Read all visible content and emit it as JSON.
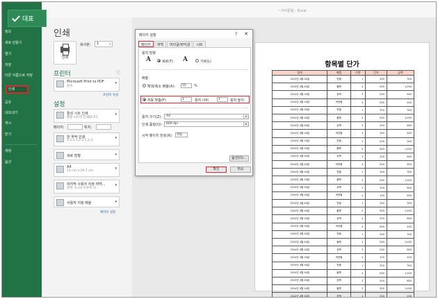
{
  "window": {
    "title": "~서식문용 - Excel"
  },
  "nav": {
    "back_label": "대표",
    "items": [
      "정보",
      "새로 만들기",
      "열기",
      "저장",
      "다른 이름으로 저장",
      "인쇄",
      "공유",
      "내보내기",
      "게시",
      "닫기",
      "계정",
      "옵션"
    ],
    "selected": "인쇄"
  },
  "print": {
    "heading": "인쇄",
    "button_label": "인쇄",
    "copies_label": "복사본:",
    "copies_value": "1",
    "printer_heading": "프린터",
    "printer_name": "Microsoft Print to PDF",
    "printer_status": "준비",
    "printer_props": "프린터 속성",
    "settings_heading": "설정",
    "setting1_title": "활성 시트 인쇄",
    "setting1_sub": "활성 시트만 인쇄합니다",
    "pages_label": "페이지:",
    "to_label": "위치:",
    "setting2_title": "한 부씩 인쇄",
    "setting2_sub": "1,2,3   1,2,3   1,2,3",
    "setting3_title": "세로 방향",
    "setting4_title": "A4",
    "setting4_sub": "21 cm x 29.7 cm",
    "setting5_title": "마지막 사용자 지정 여백...",
    "setting5_sub": "왼쪽: 0 cm   오른쪽: 0...",
    "setting6_title": "사용자 지정 배율",
    "page_setup_link": "페이지 설정"
  },
  "dialog": {
    "title": "페이지 설정",
    "help": "?",
    "close": "✕",
    "tabs": [
      "페이지",
      "여백",
      "머리글/바닥글",
      "시트"
    ],
    "active_tab": "페이지",
    "orientation_label": "용지 방향",
    "portrait": "세로(T)",
    "landscape": "가로(L)",
    "scale_label": "배율",
    "adjust_label": "확대/축소 배율(A):",
    "adjust_value": "55",
    "percent": "%",
    "fit_label": "자동 맞춤(F)",
    "fit_wide": "1",
    "wide_label": "용지 너비",
    "fit_tall": "1",
    "tall_label": "용지 높이",
    "paper_size_label": "용지 크기(Z):",
    "paper_size_value": "A4",
    "quality_label": "인쇄 품질(Q):",
    "quality_value": "600 dpi",
    "first_page_label": "시작 페이지 번호(R):",
    "first_page_value": "자동",
    "options_button": "옵션(O)...",
    "ok_button": "확인",
    "cancel_button": "취소"
  },
  "preview": {
    "title": "항목별 단가",
    "headers": [
      "일자",
      "제품",
      "수량",
      "단가",
      "금액"
    ],
    "rows": [
      [
        "2024년 4월 16일",
        "연필",
        "1",
        "300",
        "300"
      ],
      [
        "2024년 4월 16일",
        "볼펜",
        "2",
        "500",
        "1,000"
      ],
      [
        "2024년 4월 16일",
        "공책",
        "3",
        "200",
        "600"
      ],
      [
        "2024년 4월 16일",
        "색연필",
        "4",
        "500",
        "400"
      ],
      [
        "2024년 4월 16일",
        "연필",
        "1",
        "300",
        "300"
      ],
      [
        "2024년 4월 16일",
        "볼펜",
        "2",
        "500",
        "1,000"
      ],
      [
        "2024년 4월 16일",
        "공책",
        "3",
        "200",
        "600"
      ],
      [
        "2024년 4월 16일",
        "색연필",
        "4",
        "100",
        "400"
      ],
      [
        "2024년 4월 16일",
        "연필",
        "1",
        "300",
        "300"
      ],
      [
        "2024년 4월 16일",
        "볼펜",
        "2",
        "500",
        "1,000"
      ],
      [
        "2024년 4월 16일",
        "공책",
        "3",
        "200",
        "600"
      ],
      [
        "2024년 4월 16일",
        "색연필",
        "4",
        "500",
        "400"
      ],
      [
        "2024년 4월 16일",
        "연필",
        "1",
        "300",
        "300"
      ],
      [
        "2024년 4월 16일",
        "볼펜",
        "2",
        "500",
        "1,000"
      ],
      [
        "2024년 4월 16일",
        "공책",
        "3",
        "200",
        "600"
      ],
      [
        "2024년 4월 16일",
        "색연필",
        "4",
        "100",
        "400"
      ],
      [
        "2024년 4월 16일",
        "연필",
        "1",
        "300",
        "300"
      ],
      [
        "2024년 4월 16일",
        "볼펜",
        "2",
        "500",
        "1,000"
      ],
      [
        "2024년 4월 16일",
        "공책",
        "3",
        "200",
        "600"
      ],
      [
        "2024년 4월 16일",
        "색연필",
        "4",
        "500",
        "400"
      ],
      [
        "2024년 4월 16일",
        "연필",
        "1",
        "300",
        "300"
      ],
      [
        "2024년 4월 16일",
        "볼펜",
        "2",
        "500",
        "1,000"
      ],
      [
        "2024년 4월 16일",
        "공책",
        "3",
        "200",
        "600"
      ],
      [
        "2024년 4월 16일",
        "색연필",
        "4",
        "100",
        "400"
      ],
      [
        "2024년 4월 16일",
        "연필",
        "1",
        "300",
        "300"
      ],
      [
        "2024년 4월 16일",
        "볼펜",
        "2",
        "500",
        "1,000"
      ],
      [
        "2024년 4월 16일",
        "공책",
        "3",
        "200",
        "600"
      ],
      [
        "2024년 4월 16일",
        "볼펜",
        "2",
        "500",
        "1,000"
      ],
      [
        "2024년 4월 16일",
        "공책",
        "1",
        "200",
        "200"
      ]
    ]
  },
  "colors": {
    "accent_green": "#217346",
    "highlight_red": "#e0262e",
    "header_fill": "#f6d3c9"
  }
}
